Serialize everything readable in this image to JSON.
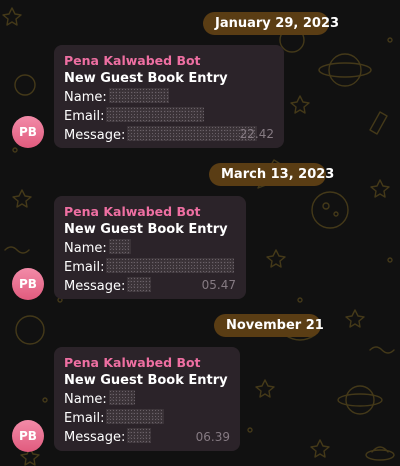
{
  "chat": {
    "messages": [
      {
        "date": "January 29, 2023",
        "sender": "Pena Kalwabed Bot",
        "title": "New Guest Book Entry",
        "name_label": "Name:",
        "email_label": "Email:",
        "message_label": "Message:",
        "time": "22.42",
        "avatar_initials": "PB"
      },
      {
        "date": "March 13, 2023",
        "sender": "Pena Kalwabed Bot",
        "title": "New Guest Book Entry",
        "name_label": "Name:",
        "email_label": "Email:",
        "message_label": "Message:",
        "time": "05.47",
        "avatar_initials": "PB"
      },
      {
        "date": "November 21",
        "sender": "Pena Kalwabed Bot",
        "title": "New Guest Book Entry",
        "name_label": "Name:",
        "email_label": "Email:",
        "message_label": "Message:",
        "time": "06.39",
        "avatar_initials": "PB"
      }
    ]
  },
  "colors": {
    "background": "#111111",
    "bubble": "#2b2329",
    "sender": "#ee6fa2",
    "date_pill": "#5a3d14",
    "avatar": "#e8708f",
    "wallpaper_doodle": "#4a3e1a"
  },
  "icons": [
    "pattern-wallpaper",
    "avatar-circle"
  ]
}
